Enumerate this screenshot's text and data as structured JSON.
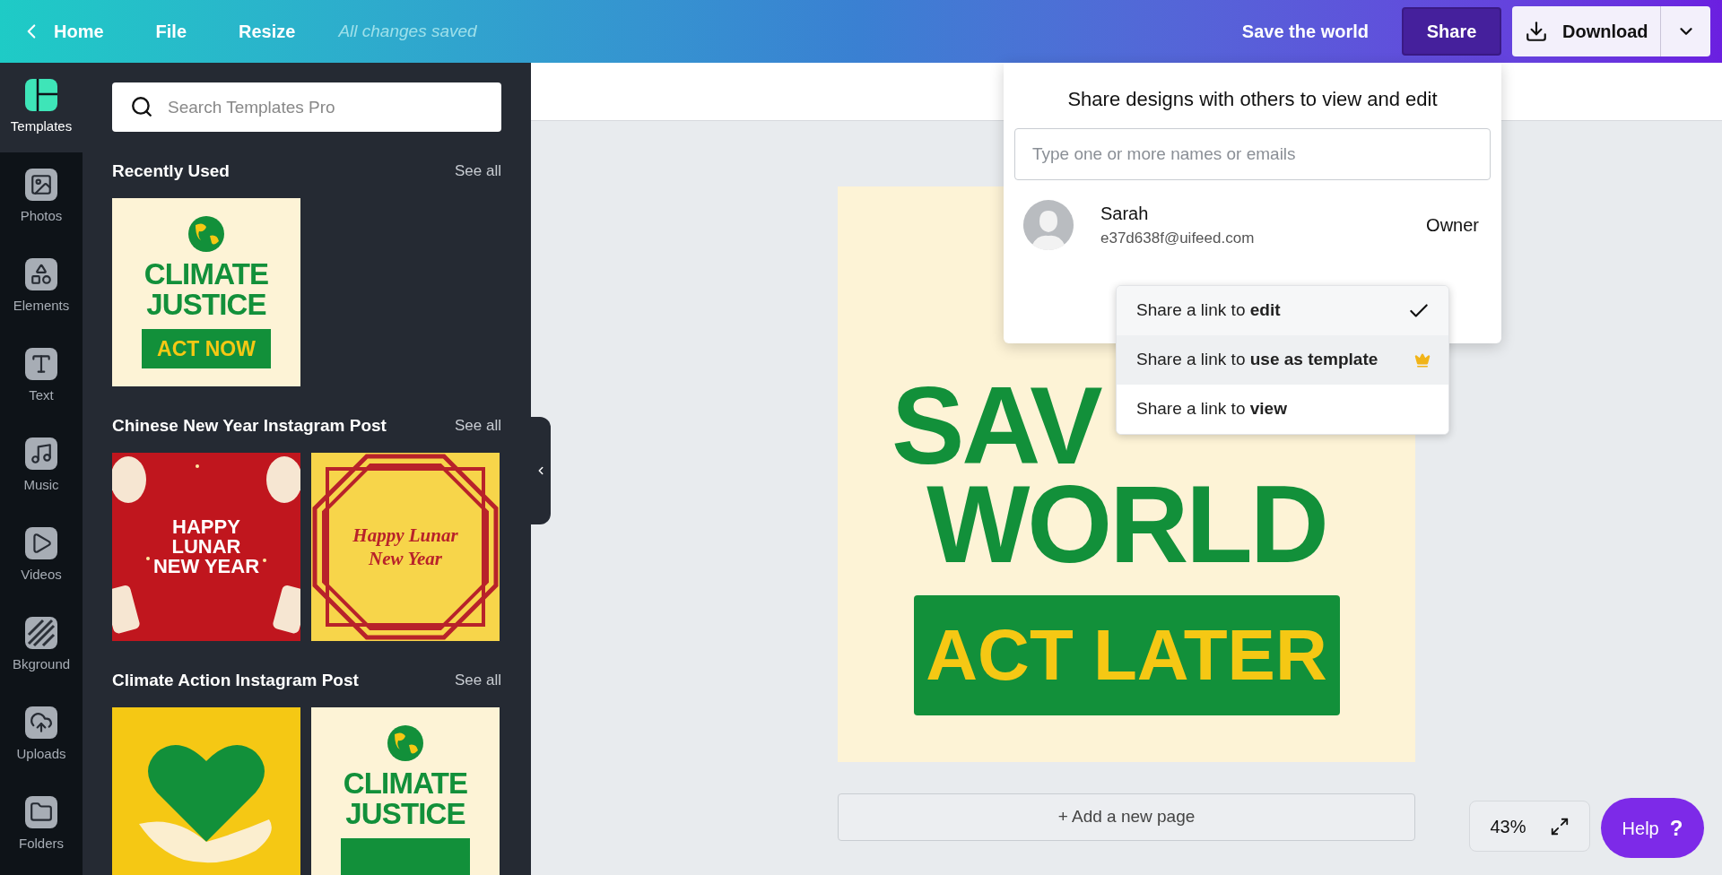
{
  "topbar": {
    "back": "Home",
    "menu": [
      "File",
      "Resize"
    ],
    "status": "All changes saved",
    "design_title": "Save the world",
    "share": "Share",
    "download": "Download"
  },
  "rail": [
    {
      "label": "Templates",
      "selected": true
    },
    {
      "label": "Photos",
      "selected": false
    },
    {
      "label": "Elements",
      "selected": false
    },
    {
      "label": "Text",
      "selected": false
    },
    {
      "label": "Music",
      "selected": false
    },
    {
      "label": "Videos",
      "selected": false
    },
    {
      "label": "Bkground",
      "selected": false
    },
    {
      "label": "Uploads",
      "selected": false
    },
    {
      "label": "Folders",
      "selected": false
    }
  ],
  "search": {
    "placeholder": "Search Templates Pro"
  },
  "sections": [
    {
      "title": "Recently Used",
      "link": "See all",
      "templates": [
        {
          "kind": "climate",
          "lines": [
            "CLIMATE",
            "JUSTICE"
          ],
          "button": "ACT NOW"
        }
      ]
    },
    {
      "title": "Chinese New Year Instagram Post",
      "link": "See all",
      "templates": [
        {
          "kind": "lunar_red",
          "lines": [
            "HAPPY",
            "LUNAR",
            "NEW YEAR"
          ]
        },
        {
          "kind": "lunar_yellow",
          "lines": [
            "Happy Lunar",
            "New Year"
          ]
        }
      ]
    },
    {
      "title": "Climate Action Instagram Post",
      "link": "See all",
      "templates": [
        {
          "kind": "heart"
        },
        {
          "kind": "climate",
          "lines": [
            "CLIMATE",
            "JUSTICE"
          ]
        }
      ]
    }
  ],
  "design": {
    "lines": [
      "SAV",
      "WORLD"
    ],
    "button": "ACT LATER"
  },
  "add_page": "+ Add a new page",
  "zoom": "43%",
  "help": {
    "label": "Help",
    "icon": "?"
  },
  "share_popup": {
    "heading": "Share designs with others to view and edit",
    "placeholder": "Type one or more names or emails",
    "people": [
      {
        "name": "Sarah",
        "email": "e37d638f@uifeed.com",
        "role": "Owner"
      }
    ],
    "link_options": [
      {
        "text": "Share a link to **edit**",
        "selected": true,
        "hovered": false,
        "premium": false
      },
      {
        "text": "Share a link to **use as template**",
        "selected": false,
        "hovered": true,
        "premium": true
      },
      {
        "text": "Share a link to **view**",
        "selected": false,
        "hovered": false,
        "premium": false
      }
    ]
  }
}
